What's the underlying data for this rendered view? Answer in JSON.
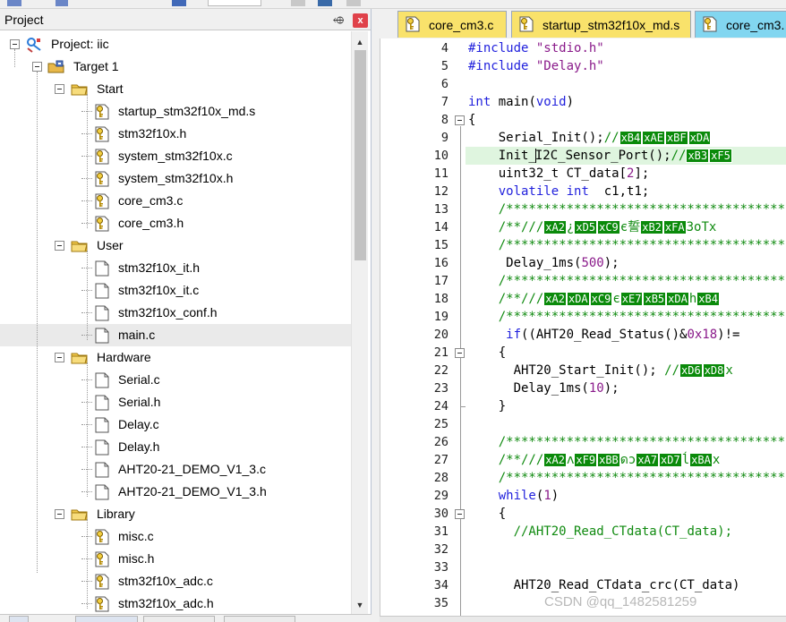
{
  "project_panel": {
    "title": "Project",
    "pin_glyph": "⬲",
    "close_glyph": "x",
    "tree": [
      {
        "label": "Project: iic",
        "kind": "project",
        "depth": 0
      },
      {
        "label": "Target 1",
        "kind": "target",
        "depth": 1
      },
      {
        "label": "Start",
        "kind": "group",
        "depth": 2
      },
      {
        "label": "startup_stm32f10x_md.s",
        "kind": "file-key",
        "depth": 3
      },
      {
        "label": "stm32f10x.h",
        "kind": "file-key",
        "depth": 3
      },
      {
        "label": "system_stm32f10x.c",
        "kind": "file-key",
        "depth": 3
      },
      {
        "label": "system_stm32f10x.h",
        "kind": "file-key",
        "depth": 3
      },
      {
        "label": "core_cm3.c",
        "kind": "file-key",
        "depth": 3
      },
      {
        "label": "core_cm3.h",
        "kind": "file-key",
        "depth": 3
      },
      {
        "label": "User",
        "kind": "group",
        "depth": 2
      },
      {
        "label": "stm32f10x_it.h",
        "kind": "file",
        "depth": 3
      },
      {
        "label": "stm32f10x_it.c",
        "kind": "file",
        "depth": 3
      },
      {
        "label": "stm32f10x_conf.h",
        "kind": "file",
        "depth": 3
      },
      {
        "label": "main.c",
        "kind": "file",
        "depth": 3,
        "selected": true
      },
      {
        "label": "Hardware",
        "kind": "group",
        "depth": 2
      },
      {
        "label": "Serial.c",
        "kind": "file",
        "depth": 3
      },
      {
        "label": "Serial.h",
        "kind": "file",
        "depth": 3
      },
      {
        "label": "Delay.c",
        "kind": "file",
        "depth": 3
      },
      {
        "label": "Delay.h",
        "kind": "file",
        "depth": 3
      },
      {
        "label": "AHT20-21_DEMO_V1_3.c",
        "kind": "file",
        "depth": 3
      },
      {
        "label": "AHT20-21_DEMO_V1_3.h",
        "kind": "file",
        "depth": 3
      },
      {
        "label": "Library",
        "kind": "group",
        "depth": 2
      },
      {
        "label": "misc.c",
        "kind": "file-key",
        "depth": 3
      },
      {
        "label": "misc.h",
        "kind": "file-key",
        "depth": 3
      },
      {
        "label": "stm32f10x_adc.c",
        "kind": "file-key",
        "depth": 3
      },
      {
        "label": "stm32f10x_adc.h",
        "kind": "file-key",
        "depth": 3
      }
    ]
  },
  "editor": {
    "tabs": [
      {
        "label": "core_cm3.c",
        "active": false
      },
      {
        "label": "startup_stm32f10x_md.s",
        "active": false
      },
      {
        "label": "core_cm3.",
        "active": false
      }
    ],
    "lines": [
      {
        "n": "4",
        "code": "#include \"stdio.h\""
      },
      {
        "n": "5",
        "code": "#include \"Delay.h\""
      },
      {
        "n": "6",
        "code": ""
      },
      {
        "n": "7",
        "code": "int main(void)"
      },
      {
        "n": "8",
        "code": "{"
      },
      {
        "n": "9",
        "code": "    Serial_Init();//xB4xAExBFxDA"
      },
      {
        "n": "10",
        "code": "    Init_I2C_Sensor_Port();//xB3xF5"
      },
      {
        "n": "11",
        "code": "    uint32_t CT_data[2];"
      },
      {
        "n": "12",
        "code": "    volatile int  c1,t1;"
      },
      {
        "n": "13",
        "code": "    /*************************************"
      },
      {
        "n": "14",
        "code": "    /**///xA2¿xD5xC9є誓xB2xFA3oTx"
      },
      {
        "n": "15",
        "code": "    /*************************************"
      },
      {
        "n": "16",
        "code": "     Delay_1ms(500);"
      },
      {
        "n": "17",
        "code": "    /*************************************"
      },
      {
        "n": "18",
        "code": "    /**///xA2xDAxC9єxE7xB5xDAhxB4"
      },
      {
        "n": "19",
        "code": "    /*************************************"
      },
      {
        "n": "20",
        "code": "     if((AHT20_Read_Status()&0x18)!="
      },
      {
        "n": "21",
        "code": "    {"
      },
      {
        "n": "22",
        "code": "      AHT20_Start_Init(); //xD6xD8x"
      },
      {
        "n": "23",
        "code": "      Delay_1ms(10);"
      },
      {
        "n": "24",
        "code": "    }"
      },
      {
        "n": "25",
        "code": ""
      },
      {
        "n": "26",
        "code": "    /*************************************"
      },
      {
        "n": "27",
        "code": "    /**///xA2ʌxF9xBBดɔxA7xD7ĺxBAx"
      },
      {
        "n": "28",
        "code": "    /*************************************"
      },
      {
        "n": "29",
        "code": "    while(1)"
      },
      {
        "n": "30",
        "code": "    {"
      },
      {
        "n": "31",
        "code": "      //AHT20_Read_CTdata(CT_data);"
      },
      {
        "n": "32",
        "code": ""
      },
      {
        "n": "33",
        "code": ""
      },
      {
        "n": "34",
        "code": "      AHT20_Read_CTdata_crc(CT_data)"
      },
      {
        "n": "35",
        "code": ""
      }
    ]
  },
  "watermark": "CSDN @qq_1482581259",
  "colors": {
    "keyword": "#2222dd",
    "comment": "#0f8a0f",
    "string": "#8a1a8a",
    "hex_badge": "#0a8a0a",
    "current_line": "#dff5df",
    "tab_c_file": "#f9e26b",
    "tab_h_file": "#82d6f0",
    "close_button": "#e0424a"
  },
  "icons": [
    "pin-icon",
    "close-icon",
    "project-icon",
    "target-icon",
    "folder-icon",
    "file-key-icon",
    "file-icon"
  ]
}
